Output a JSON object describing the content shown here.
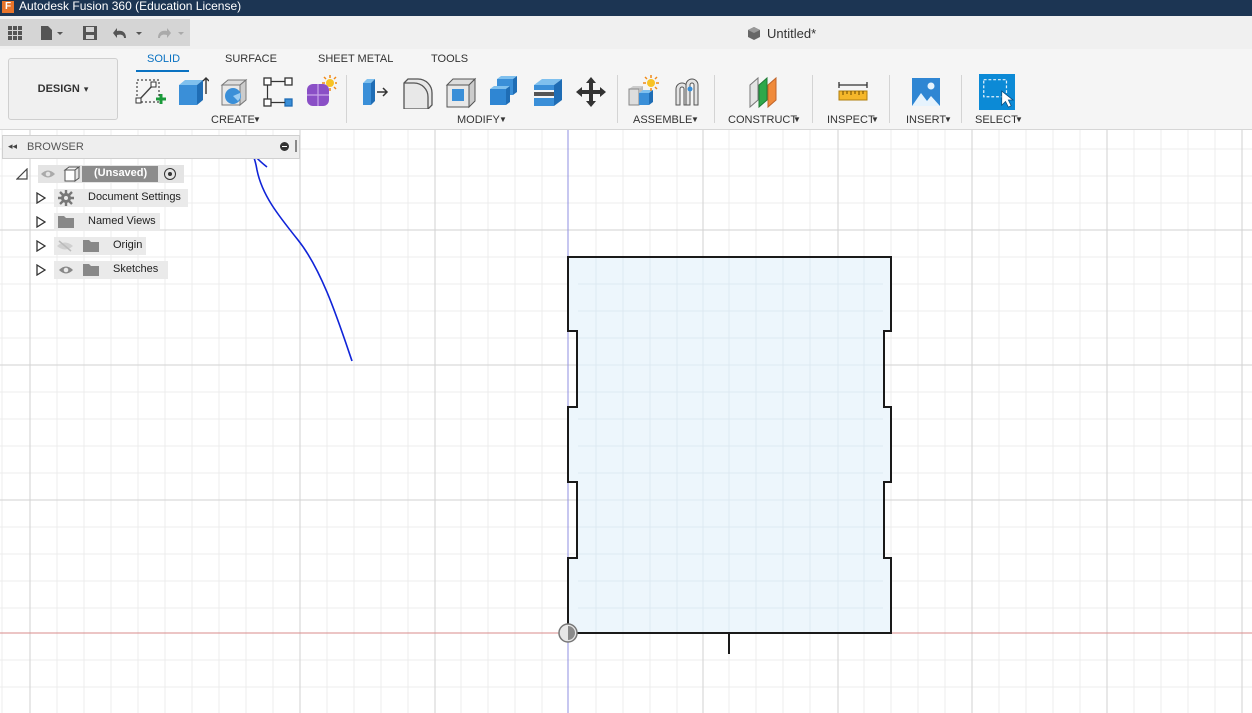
{
  "titlebar": {
    "app_title": "Autodesk Fusion 360 (Education License)",
    "logo_letter": "F"
  },
  "document": {
    "title": "Untitled*"
  },
  "workspace": {
    "label": "DESIGN",
    "dropdown": "▾"
  },
  "tabs": [
    {
      "label": "SOLID"
    },
    {
      "label": "SURFACE"
    },
    {
      "label": "SHEET METAL"
    },
    {
      "label": "TOOLS"
    }
  ],
  "groups": {
    "create": "CREATE",
    "modify": "MODIFY",
    "assemble": "ASSEMBLE",
    "construct": "CONSTRUCT",
    "inspect": "INSPECT",
    "insert": "INSERT",
    "select": "SELECT"
  },
  "browser": {
    "title": "BROWSER",
    "root": "(Unsaved)",
    "items": [
      {
        "label": "Document Settings"
      },
      {
        "label": "Named Views"
      },
      {
        "label": "Origin"
      },
      {
        "label": "Sketches"
      }
    ]
  },
  "colors": {
    "titlebar": "#1c3553",
    "accent": "#0a72c2",
    "sketch_fill": "#edf6fc",
    "annotation": "#1024d8",
    "axis_vertical": "#8f8fe0",
    "axis_horizontal": "#d98b8b"
  },
  "icons": {
    "grid": "grid-icon",
    "file": "file-icon",
    "save": "save-icon",
    "undo": "undo-icon",
    "redo": "redo-icon"
  }
}
